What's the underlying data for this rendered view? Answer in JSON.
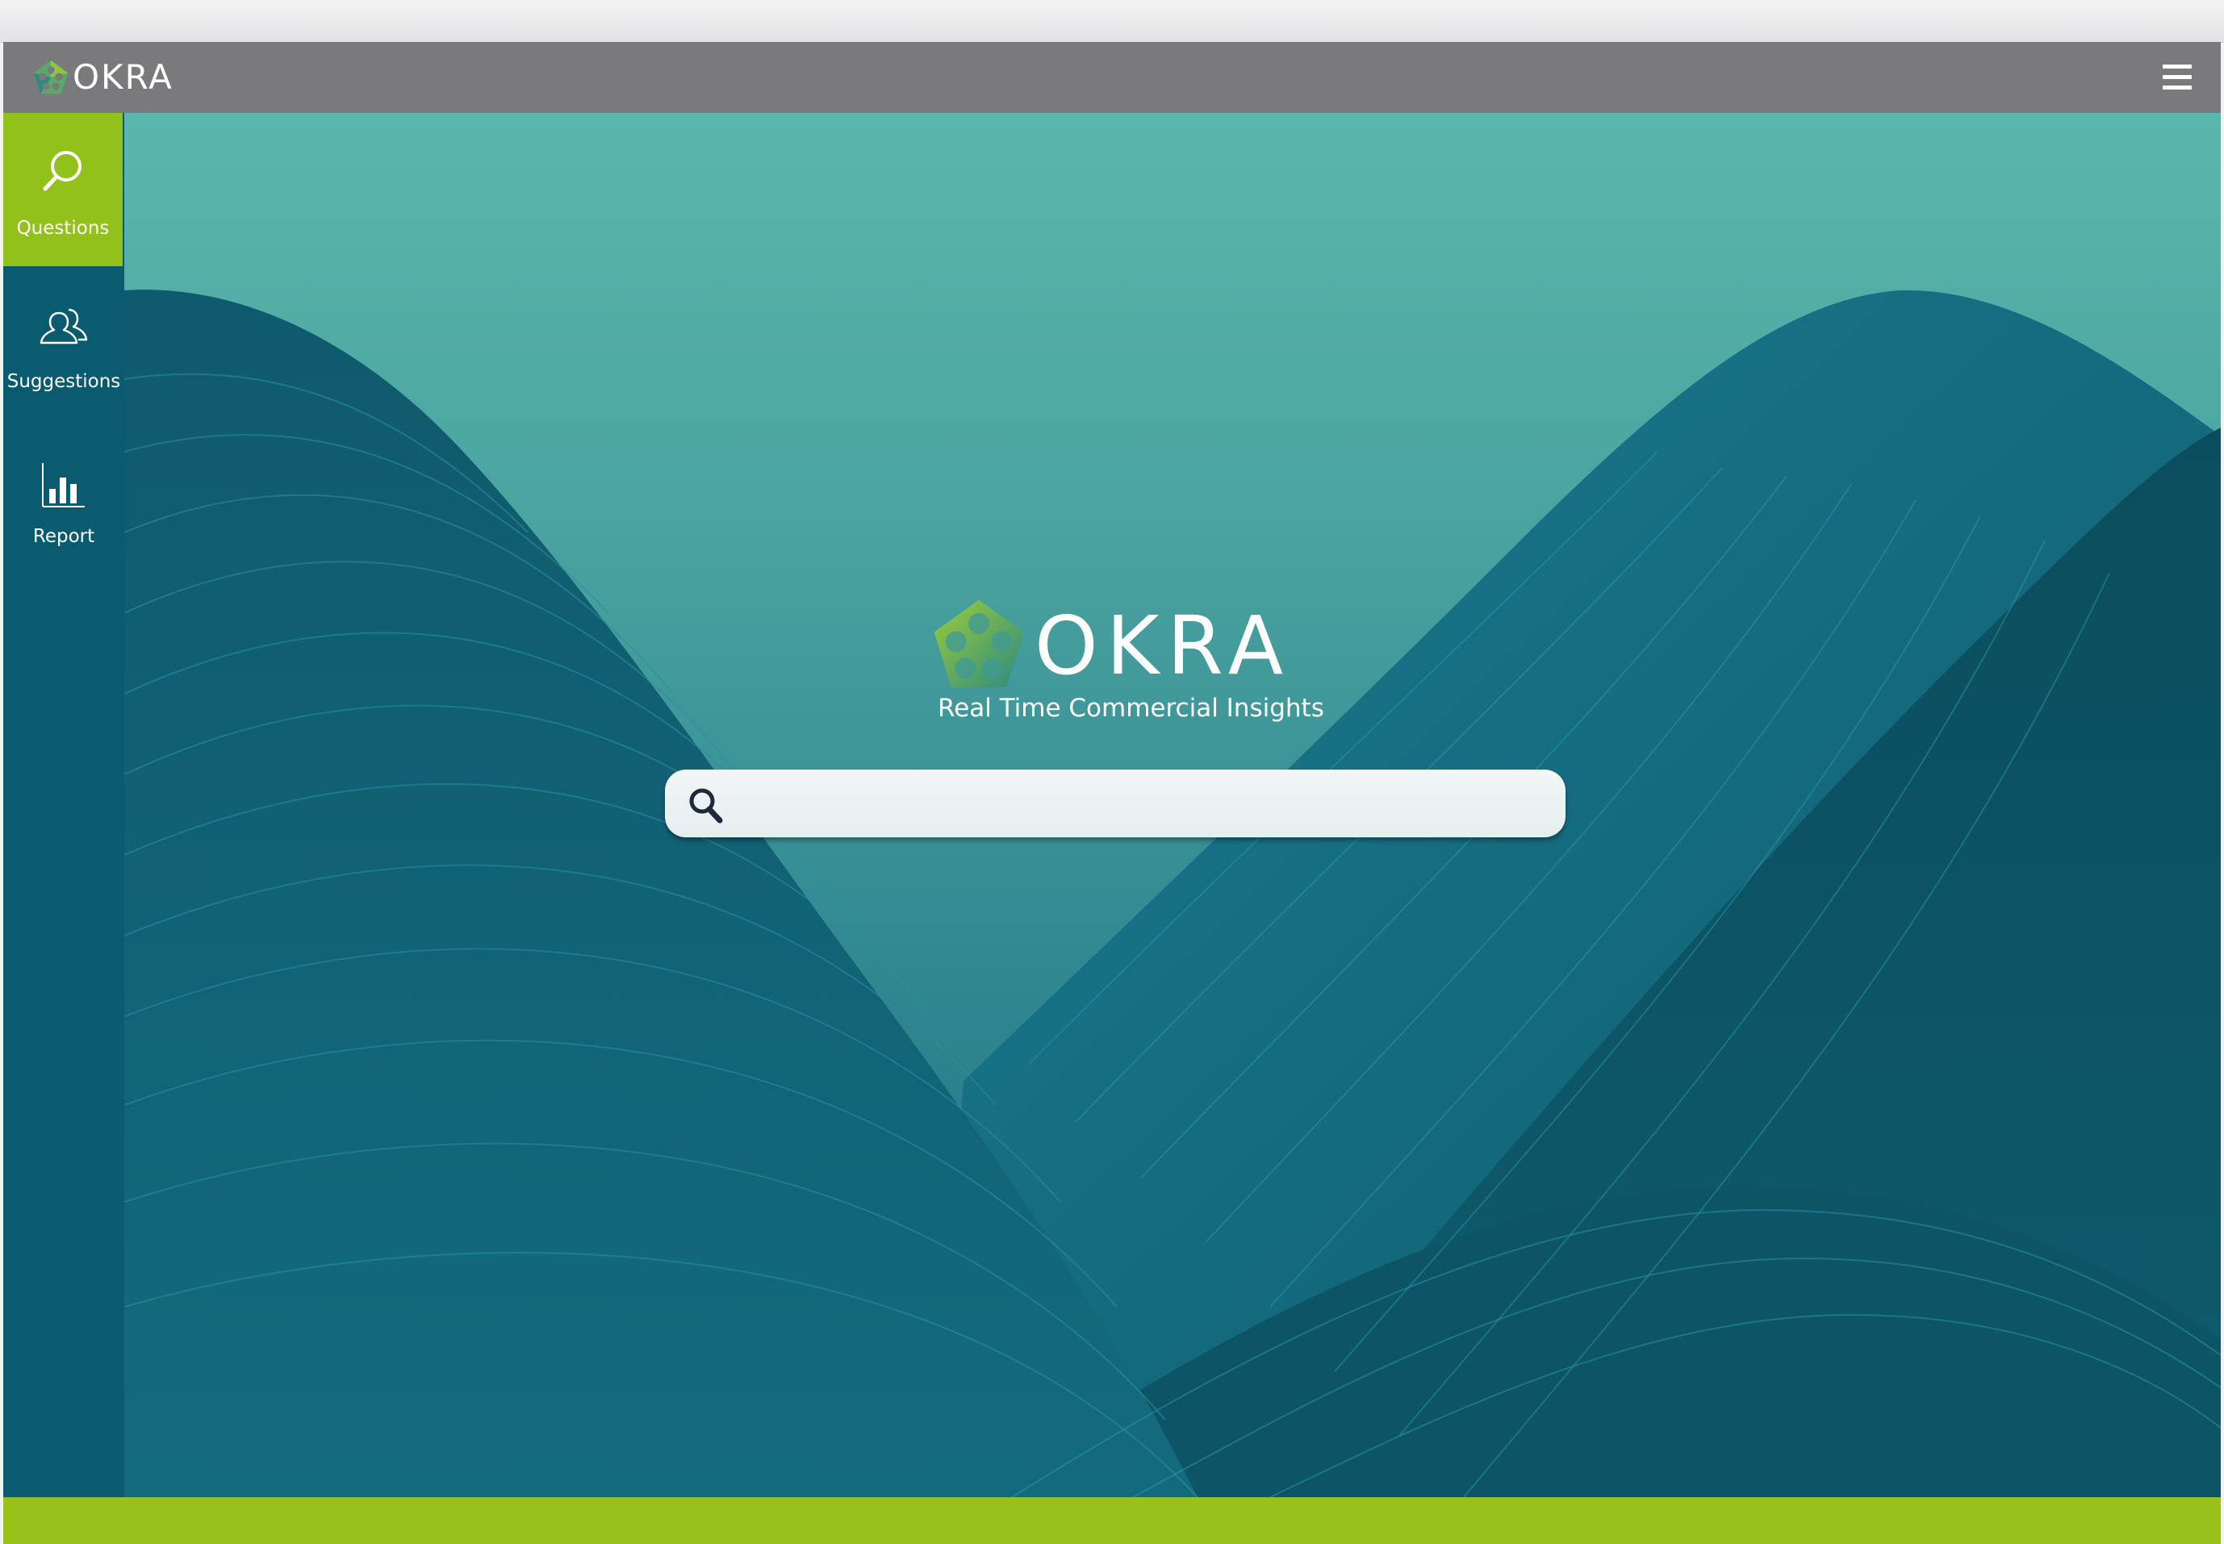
{
  "app": {
    "name": "OKRA",
    "tagline": "Real Time Commercial Insights"
  },
  "topbar": {
    "logo_text": "OKRA",
    "menu_icon": "hamburger-menu-icon"
  },
  "sidebar": {
    "items": [
      {
        "label": "Questions",
        "icon": "search-icon",
        "active": true
      },
      {
        "label": "Suggestions",
        "icon": "users-icon",
        "active": false
      },
      {
        "label": "Report",
        "icon": "bar-chart-icon",
        "active": false
      }
    ]
  },
  "search": {
    "value": "",
    "placeholder": "",
    "icon": "search-icon"
  },
  "colors": {
    "sidebar": "#0b5b70",
    "sidebar_active": "#93c11b",
    "topbar": "#7a7a7c",
    "bottombar": "#98c11c",
    "hero_top": "#5bb7ad",
    "hero_bottom": "#1a6b7d"
  }
}
